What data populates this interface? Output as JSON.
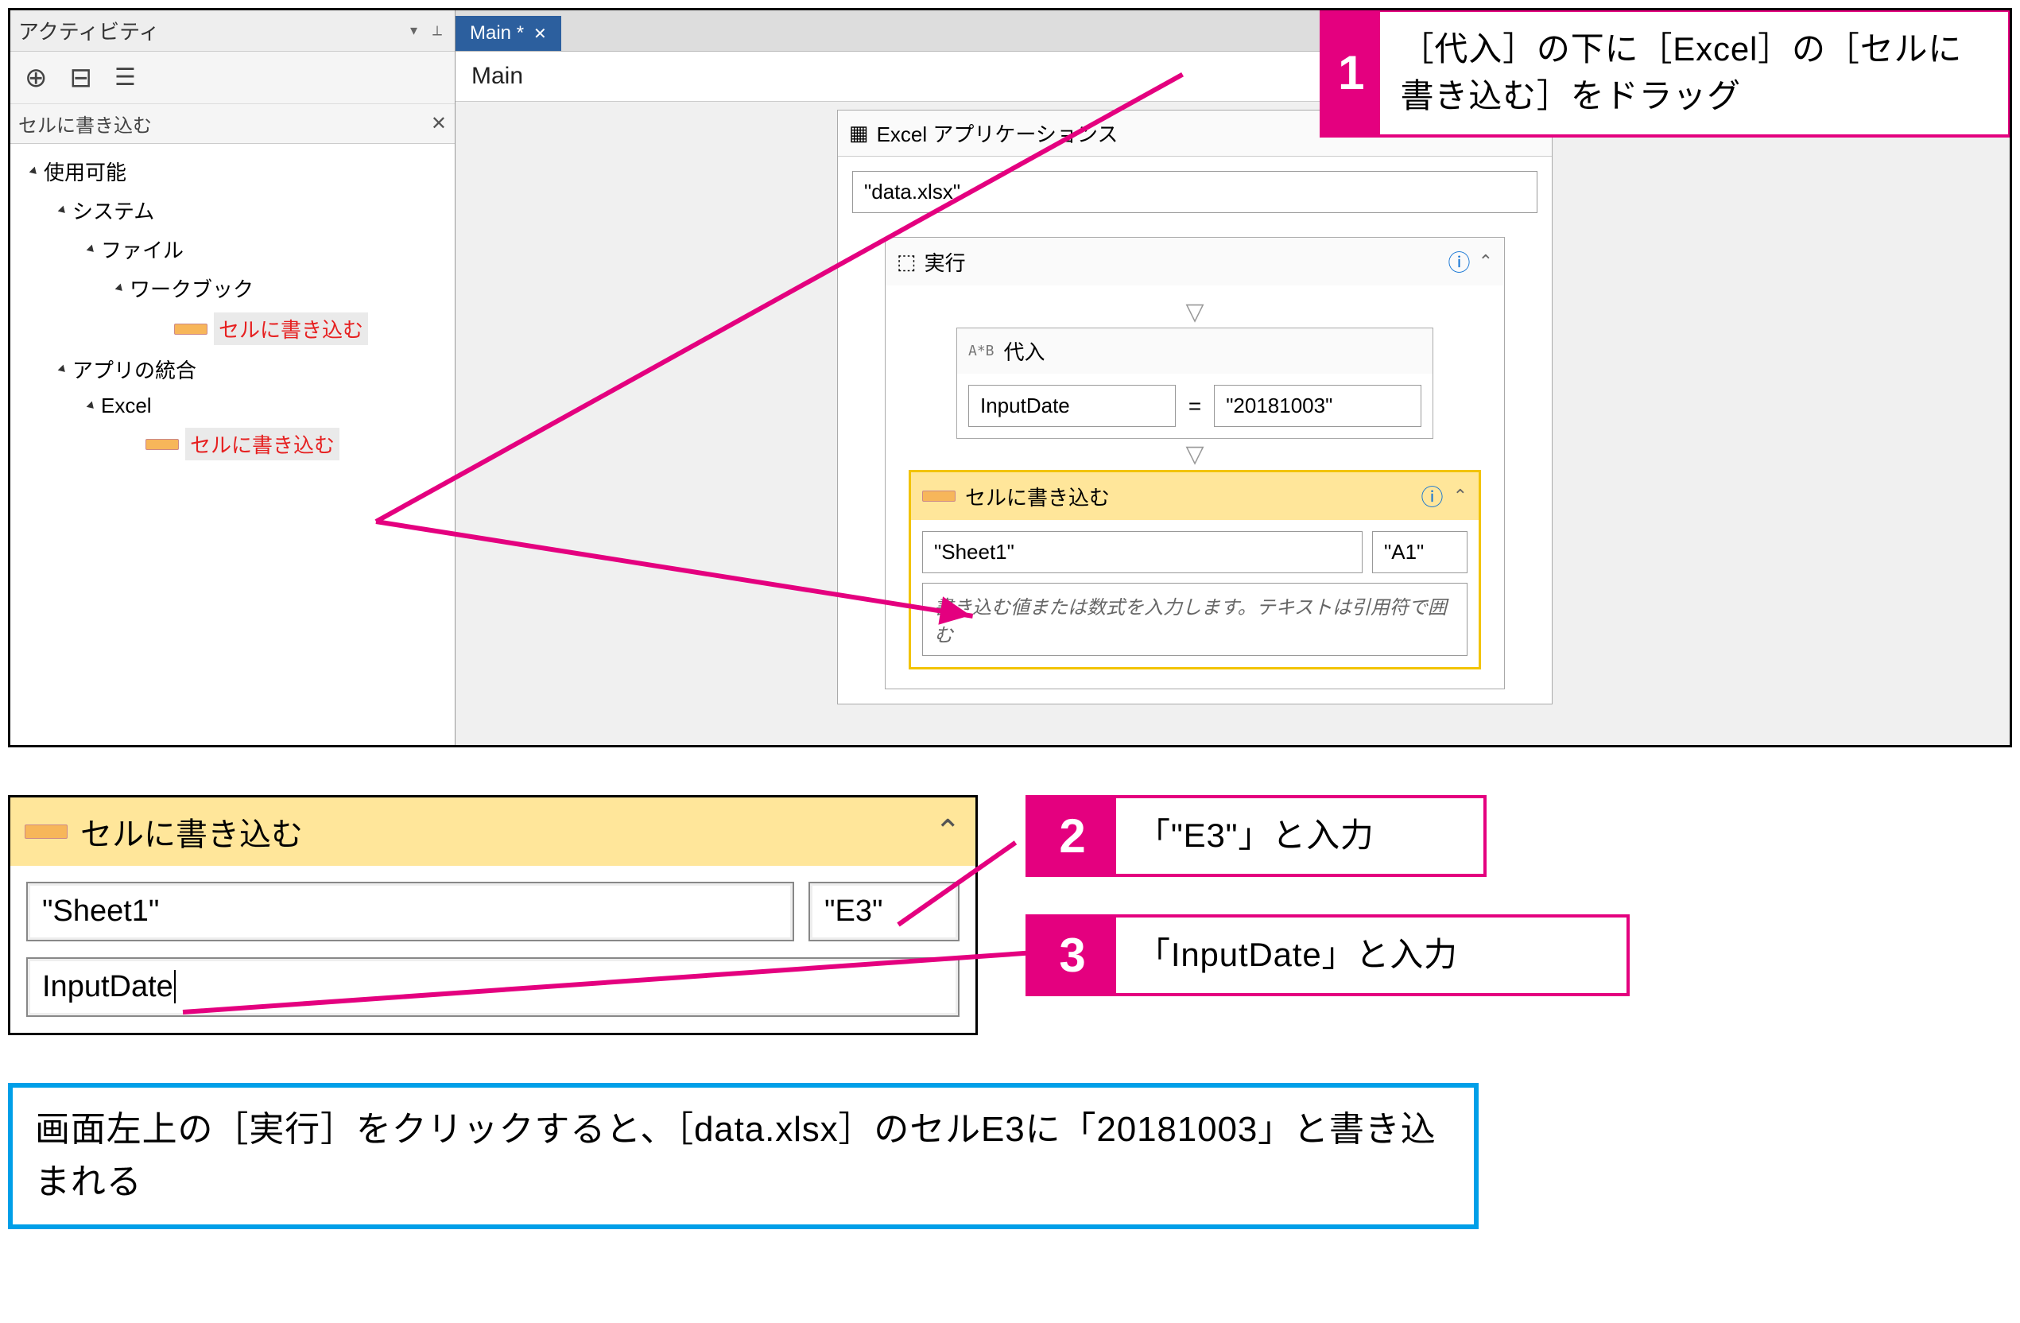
{
  "panel": {
    "title": "アクティビティ",
    "search_text": "セルに書き込む",
    "tree": {
      "root": "使用可能",
      "system": "システム",
      "file": "ファイル",
      "workbook": "ワークブック",
      "write1": "セルに書き込む",
      "integration": "アプリの統合",
      "excel": "Excel",
      "write2": "セルに書き込む"
    }
  },
  "tab": {
    "label": "Main *",
    "breadcrumb": "Main"
  },
  "scope": {
    "title": "Excel アプリケーションス",
    "path": "\"data.xlsx\""
  },
  "exec": {
    "title": "実行"
  },
  "assign": {
    "title": "代入",
    "left": "InputDate",
    "right": "\"20181003\""
  },
  "write": {
    "title": "セルに書き込む",
    "sheet": "\"Sheet1\"",
    "cell": "\"A1\"",
    "hint": "書き込む値または数式を入力します。テキストは引用符で囲む"
  },
  "callouts": {
    "c1": {
      "num": "1",
      "text": "［代入］の下に［Excel］の［セルに書き込む］をドラッグ"
    },
    "c2": {
      "num": "2",
      "text": "「\"E3\"」と入力"
    },
    "c3": {
      "num": "3",
      "text": "「InputDate」と入力"
    }
  },
  "detail": {
    "title": "セルに書き込む",
    "sheet": "\"Sheet1\"",
    "cell": "\"E3\"",
    "value": "InputDate"
  },
  "note": "画面左上の［実行］をクリックすると、［data.xlsx］のセルE3に「20181003」と書き込まれる"
}
